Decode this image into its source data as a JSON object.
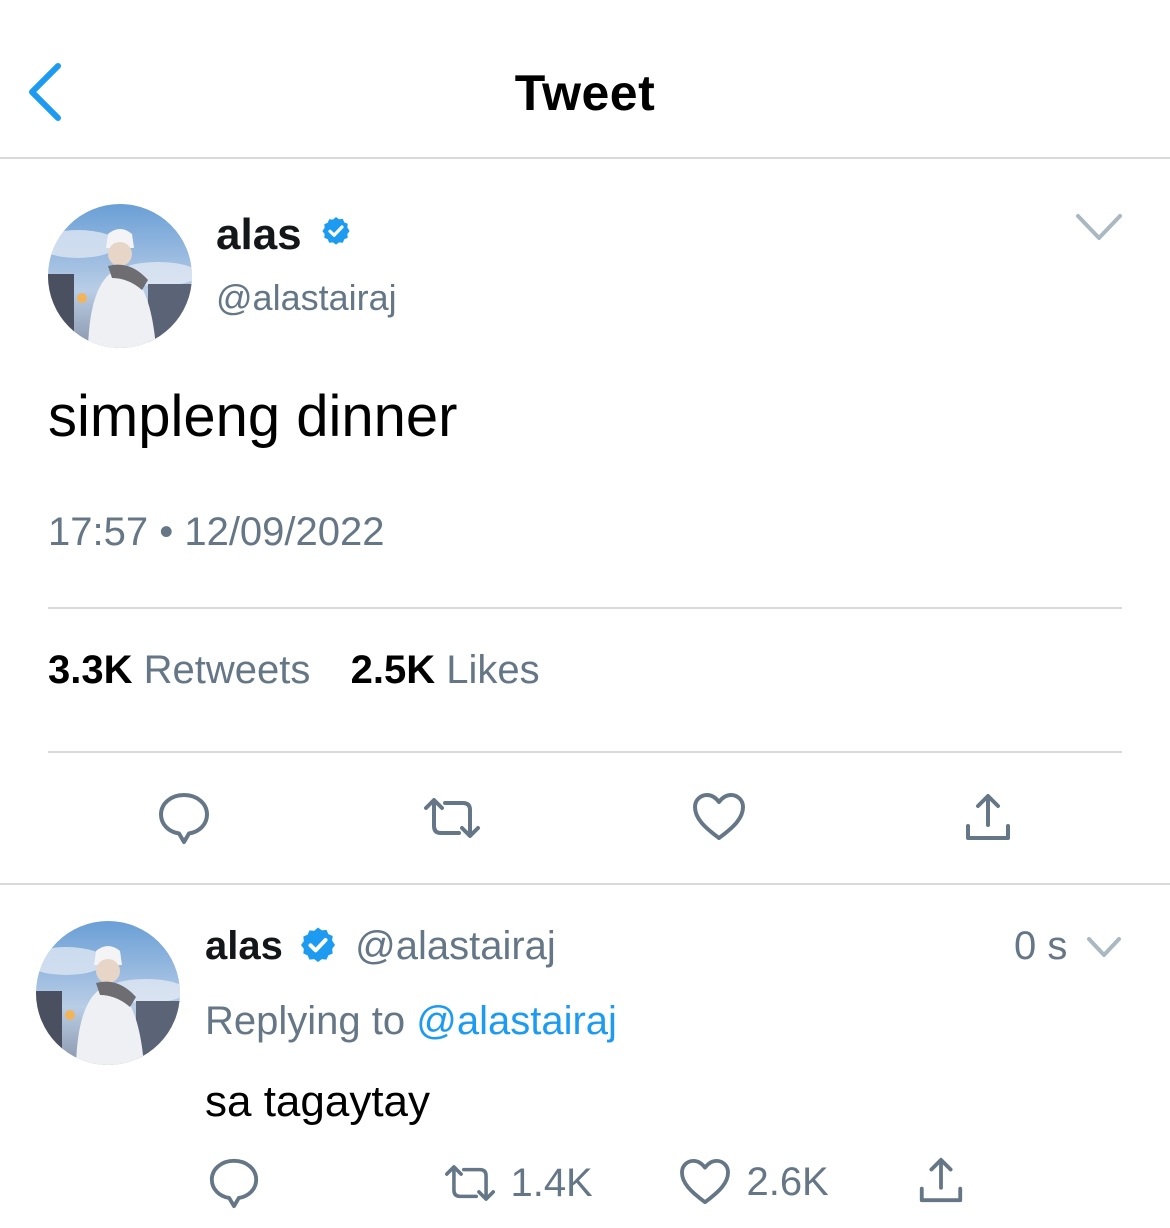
{
  "header": {
    "title": "Tweet",
    "back_icon": "chevron-left-icon"
  },
  "colors": {
    "accent": "#1d9bf0",
    "text": "#14171a",
    "secondary": "#657786",
    "divider": "#d7d9db"
  },
  "tweet": {
    "author": {
      "name": "alas",
      "handle": "@alastairaj",
      "verified": true
    },
    "text": "simpleng dinner",
    "timestamp": "17:57 • 12/09/2022",
    "stats": {
      "retweets_count": "3.3K",
      "retweets_label": "Retweets",
      "likes_count": "2.5K",
      "likes_label": "Likes"
    },
    "actions": [
      "reply-icon",
      "retweet-icon",
      "like-icon",
      "share-icon"
    ]
  },
  "reply": {
    "author": {
      "name": "alas",
      "handle": "@alastairaj",
      "verified": true
    },
    "time": "0 s",
    "replying_prefix": "Replying to",
    "replying_to": "@alastairaj",
    "text": "sa tagaytay",
    "retweet_count": "1.4K",
    "like_count": "2.6K"
  }
}
